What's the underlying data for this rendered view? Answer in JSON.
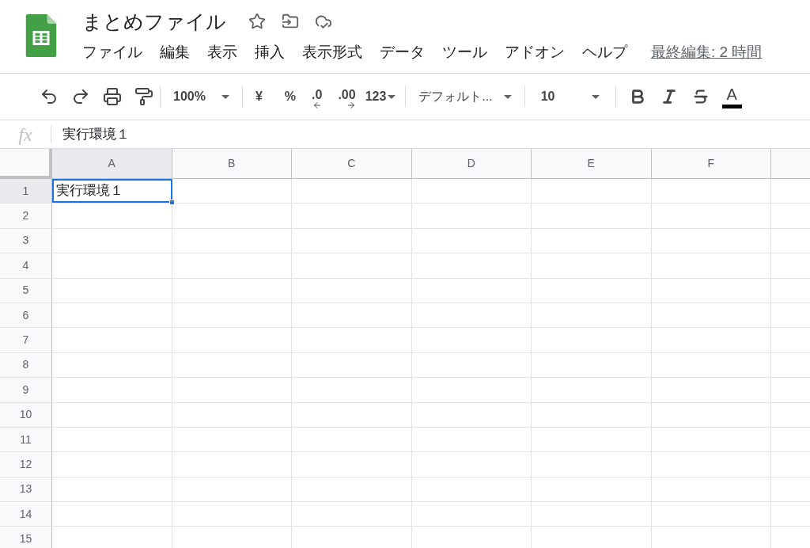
{
  "document": {
    "title": "まとめファイル"
  },
  "menu": [
    "ファイル",
    "編集",
    "表示",
    "挿入",
    "表示形式",
    "データ",
    "ツール",
    "アドオン",
    "ヘルプ"
  ],
  "last_edit": "最終編集: 2 時間",
  "toolbar": {
    "zoom": "100%",
    "currency": "¥",
    "percent": "%",
    "decrease_decimal": ".0",
    "increase_decimal": ".00",
    "more_formats": "123",
    "font": "デフォルト...",
    "font_size": "10",
    "text_color_label": "A"
  },
  "formula_bar": {
    "label": "fx",
    "value": "実行環境１"
  },
  "grid": {
    "columns": [
      {
        "label": "A",
        "selected": true
      },
      {
        "label": "B",
        "selected": false
      },
      {
        "label": "C",
        "selected": false
      },
      {
        "label": "D",
        "selected": false
      },
      {
        "label": "E",
        "selected": false
      },
      {
        "label": "F",
        "selected": false
      }
    ],
    "rows": [
      {
        "label": "1",
        "selected": true,
        "cells": [
          {
            "value": "実行環境１",
            "selected": true
          }
        ]
      },
      {
        "label": "2",
        "selected": false,
        "cells": []
      },
      {
        "label": "3",
        "selected": false,
        "cells": []
      },
      {
        "label": "4",
        "selected": false,
        "cells": []
      },
      {
        "label": "5",
        "selected": false,
        "cells": []
      },
      {
        "label": "6",
        "selected": false,
        "cells": []
      },
      {
        "label": "7",
        "selected": false,
        "cells": []
      },
      {
        "label": "8",
        "selected": false,
        "cells": []
      },
      {
        "label": "9",
        "selected": false,
        "cells": []
      },
      {
        "label": "10",
        "selected": false,
        "cells": []
      },
      {
        "label": "11",
        "selected": false,
        "cells": []
      },
      {
        "label": "12",
        "selected": false,
        "cells": []
      },
      {
        "label": "13",
        "selected": false,
        "cells": []
      },
      {
        "label": "14",
        "selected": false,
        "cells": []
      },
      {
        "label": "15",
        "selected": false,
        "cells": []
      }
    ]
  }
}
